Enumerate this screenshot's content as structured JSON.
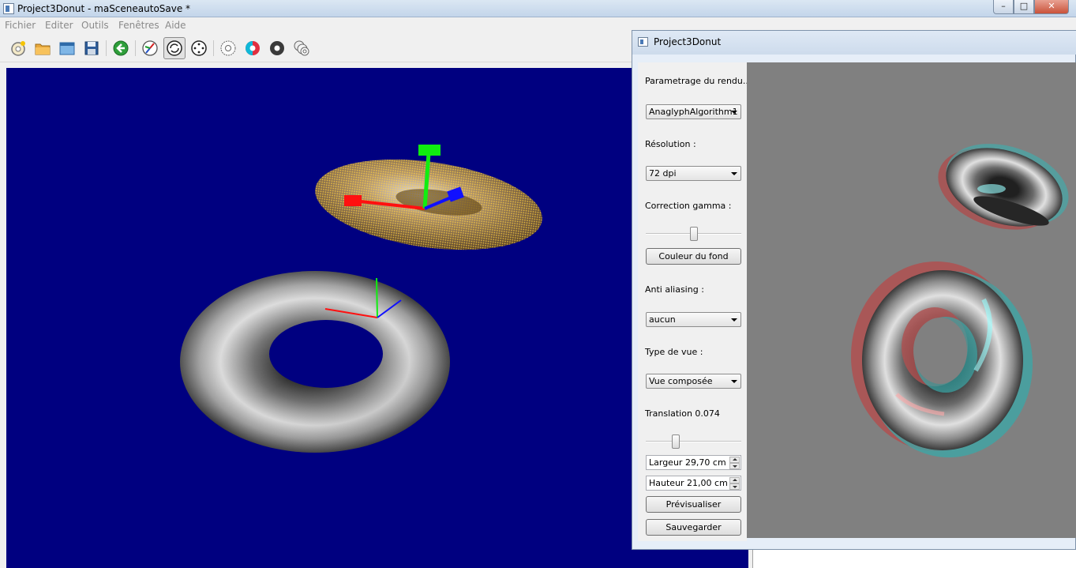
{
  "main_window": {
    "title": "Project3Donut - maSceneautoSave *",
    "controls": {
      "minimize": "–",
      "maximize": "□",
      "close": "✕"
    }
  },
  "menu": [
    "Fichier",
    "Editer",
    "Outils",
    "Fenêtres",
    "Aide"
  ],
  "toolbar": {
    "icons": [
      "new-scene-icon",
      "open-folder-icon",
      "window-icon",
      "save-icon",
      "back-arrow-icon",
      "compass-icon",
      "rotate-icon",
      "move-icon",
      "torus-outline-icon",
      "color-torus-icon",
      "dark-torus-icon",
      "multi-torus-icon"
    ],
    "active": "rotate-icon"
  },
  "viewport": {
    "background": "#000080"
  },
  "render_window": {
    "title": "Project3Donut",
    "render_settings_label": "Parametrage du rendu...",
    "algorithm": {
      "selected": "AnaglyphAlgorithm1"
    },
    "resolution": {
      "label": "Résolution :",
      "selected": "72 dpi"
    },
    "gamma": {
      "label": "Correction gamma :",
      "level_fraction": 0.5
    },
    "background_color_button": "Couleur du fond",
    "antialiasing": {
      "label": "Anti aliasing :",
      "selected": "aucun"
    },
    "view_type": {
      "label": "Type de vue :",
      "selected": "Vue composée"
    },
    "translation": {
      "label": "Translation 0.074",
      "level_fraction": 0.3
    },
    "width_field": "Largeur 29,70 cm",
    "height_field": "Hauteur 21,00 cm",
    "preview_button": "Prévisualiser",
    "save_button": "Sauvegarder",
    "preview_background": "#808080"
  }
}
